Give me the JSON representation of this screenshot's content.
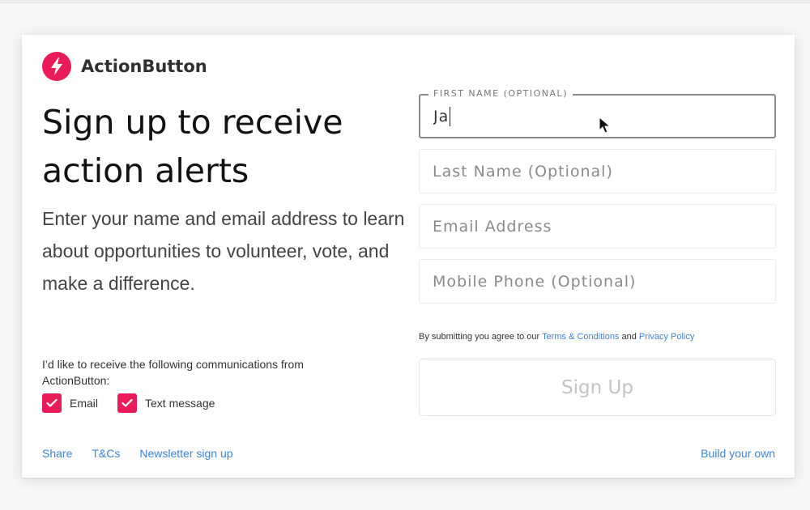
{
  "brand": {
    "name": "ActionButton",
    "logo_icon": "lightning-bolt-icon",
    "accent_color": "#ea1b59"
  },
  "headline": "Sign up to receive action alerts",
  "subtext": "Enter your name and email address to learn about opportunities to volunteer, vote, and make a difference.",
  "form": {
    "first_name": {
      "legend": "FIRST NAME (OPTIONAL)",
      "value": "Ja"
    },
    "last_name": {
      "placeholder": "Last Name (Optional)",
      "value": ""
    },
    "email": {
      "placeholder": "Email Address",
      "value": ""
    },
    "mobile": {
      "placeholder": "Mobile Phone (Optional)",
      "value": ""
    },
    "terms": {
      "prefix": "By submitting you agree to our ",
      "terms_link": "Terms & Conditions",
      "joiner": " and ",
      "privacy_link": "Privacy Policy"
    },
    "submit_label": "Sign Up"
  },
  "communications": {
    "label": "I’d like to receive the following communications from ActionButton:",
    "options": [
      {
        "label": "Email",
        "checked": true
      },
      {
        "label": "Text message",
        "checked": true
      }
    ]
  },
  "footer": {
    "links": [
      "Share",
      "T&Cs",
      "Newsletter sign up"
    ],
    "build_own": "Build your own"
  },
  "colors": {
    "link": "#3f86cf",
    "checkbox": "#ea1b59"
  }
}
